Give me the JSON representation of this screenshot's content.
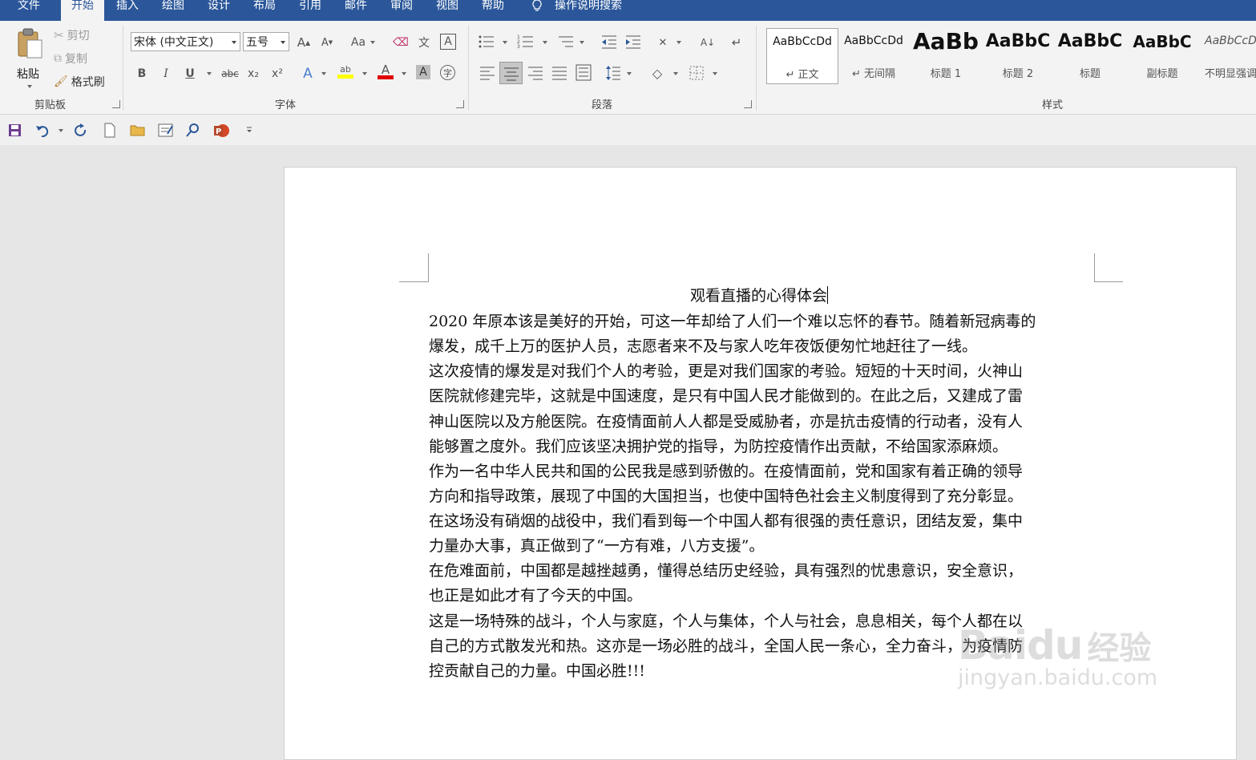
{
  "tabs": [
    {
      "label": "文件",
      "active": false
    },
    {
      "label": "开始",
      "active": true
    },
    {
      "label": "插入",
      "active": false
    },
    {
      "label": "绘图",
      "active": false
    },
    {
      "label": "设计",
      "active": false
    },
    {
      "label": "布局",
      "active": false
    },
    {
      "label": "引用",
      "active": false
    },
    {
      "label": "邮件",
      "active": false
    },
    {
      "label": "审阅",
      "active": false
    },
    {
      "label": "视图",
      "active": false
    },
    {
      "label": "帮助",
      "active": false
    }
  ],
  "tell_me": {
    "label": "操作说明搜索",
    "icon": "lightbulb-icon"
  },
  "clipboard": {
    "group_label": "剪贴板",
    "paste_label": "粘贴",
    "cut_label": "剪切",
    "copy_label": "复制",
    "format_painter_label": "格式刷"
  },
  "font": {
    "group_label": "字体",
    "font_name": "宋体 (中文正文)",
    "font_size": "五号",
    "grow_label": "A",
    "shrink_label": "A",
    "change_case_label": "Aa",
    "bold": "B",
    "italic": "I",
    "underline": "U",
    "strike": "abc",
    "subscript": "x₂",
    "superscript": "x²",
    "effects_label": "A",
    "highlight_label": "ab",
    "font_color_label": "A",
    "char_shading_label": "A",
    "enclose_label": "字",
    "phonetic_label": "文",
    "border_label": "A",
    "highlight_color": "#ffff00",
    "font_color": "#e00000"
  },
  "paragraph": {
    "group_label": "段落"
  },
  "styles": {
    "group_label": "样式",
    "items": [
      {
        "sample": "AaBbCcDd",
        "name": "↵ 正文"
      },
      {
        "sample": "AaBbCcDd",
        "name": "↵ 无间隔"
      },
      {
        "sample": "AaBb",
        "name": "标题 1"
      },
      {
        "sample": "AaBbC",
        "name": "标题 2"
      },
      {
        "sample": "AaBbC",
        "name": "标题"
      },
      {
        "sample": "AaBbC",
        "name": "副标题"
      },
      {
        "sample": "AaBbCcD",
        "name": "不明显强调"
      }
    ]
  },
  "document": {
    "title": "观看直播的心得体会",
    "lines": [
      "2020 年原本该是美好的开始，可这一年却给了人们一个难以忘怀的春节。随着新冠病毒的",
      "爆发，成千上万的医护人员，志愿者来不及与家人吃年夜饭便匆忙地赶往了一线。",
      "这次疫情的爆发是对我们个人的考验，更是对我们国家的考验。短短的十天时间，火神山",
      "医院就修建完毕，这就是中国速度，是只有中国人民才能做到的。在此之后，又建成了雷",
      "神山医院以及方舱医院。在疫情面前人人都是受威胁者，亦是抗击疫情的行动者，没有人",
      "能够置之度外。我们应该坚决拥护党的指导，为防控疫情作出贡献，不给国家添麻烦。",
      "作为一名中华人民共和国的公民我是感到骄傲的。在疫情面前，党和国家有着正确的领导",
      "方向和指导政策，展现了中国的大国担当，也使中国特色社会主义制度得到了充分彰显。",
      "在这场没有硝烟的战役中，我们看到每一个中国人都有很强的责任意识，团结友爱，集中",
      "力量办大事，真正做到了“一方有难，八方支援”。",
      "在危难面前，中国都是越挫越勇，懂得总结历史经验，具有强烈的忧患意识，安全意识，",
      "也正是如此才有了今天的中国。",
      "这是一场特殊的战斗，个人与家庭，个人与集体，个人与社会，息息相关，每个人都在以",
      "自己的方式散发光和热。这亦是一场必胜的战斗，全国人民一条心，全力奋斗，为疫情防",
      "控贡献自己的力量。中国必胜!!!"
    ]
  },
  "watermark": {
    "brand": "Baidu",
    "cn": "经验",
    "url": "jingyan.baidu.com"
  },
  "colors": {
    "accent": "#2b579a",
    "ribbon_bg": "#f3f3f3",
    "page_bg": "#ffffff"
  }
}
